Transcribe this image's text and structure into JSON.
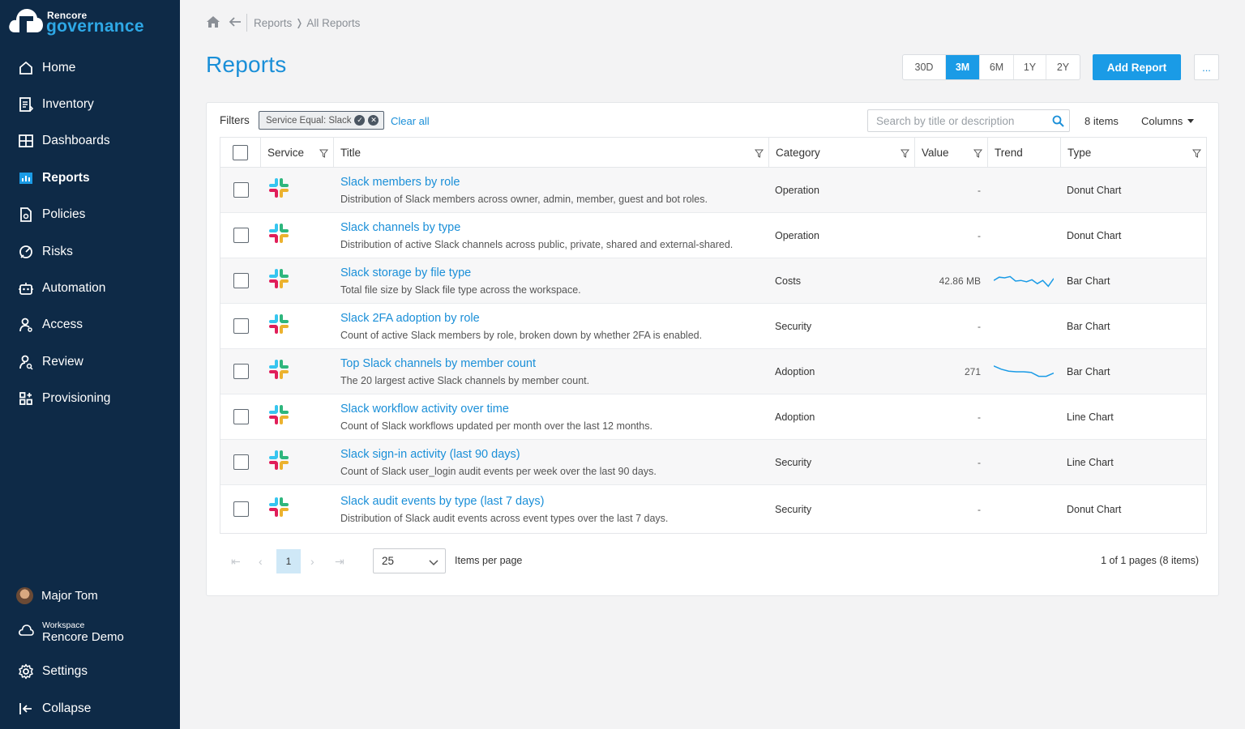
{
  "brand": {
    "top": "Rencore",
    "bottom": "governance"
  },
  "nav": [
    {
      "label": "Home",
      "icon": "home-icon"
    },
    {
      "label": "Inventory",
      "icon": "inventory-icon"
    },
    {
      "label": "Dashboards",
      "icon": "dashboards-icon"
    },
    {
      "label": "Reports",
      "icon": "reports-icon",
      "active": true
    },
    {
      "label": "Policies",
      "icon": "policies-icon"
    },
    {
      "label": "Risks",
      "icon": "risks-icon"
    },
    {
      "label": "Automation",
      "icon": "automation-icon"
    },
    {
      "label": "Access",
      "icon": "access-icon"
    },
    {
      "label": "Review",
      "icon": "review-icon"
    },
    {
      "label": "Provisioning",
      "icon": "provisioning-icon"
    }
  ],
  "user": {
    "name": "Major Tom"
  },
  "workspace": {
    "label": "Workspace",
    "name": "Rencore Demo"
  },
  "settings_label": "Settings",
  "collapse_label": "Collapse",
  "breadcrumb": {
    "parent": "Reports",
    "current": "All Reports"
  },
  "page_title": "Reports",
  "ranges": [
    "30D",
    "3M",
    "6M",
    "1Y",
    "2Y"
  ],
  "active_range": "3M",
  "add_report_label": "Add Report",
  "more_label": "...",
  "filters": {
    "label": "Filters",
    "chip": "Service Equal: Slack",
    "clear_all": "Clear all",
    "search_placeholder": "Search by title or description",
    "items_count": "8 items",
    "columns_label": "Columns"
  },
  "table": {
    "headers": {
      "service": "Service",
      "title": "Title",
      "category": "Category",
      "value": "Value",
      "trend": "Trend",
      "type": "Type"
    },
    "rows": [
      {
        "title": "Slack members by role",
        "desc": "Distribution of Slack members across owner, admin, member, guest and bot roles.",
        "category": "Operation",
        "value": "-",
        "trend": null,
        "type": "Donut Chart"
      },
      {
        "title": "Slack channels by type",
        "desc": "Distribution of active Slack channels across public, private, shared and external-shared.",
        "category": "Operation",
        "value": "-",
        "trend": null,
        "type": "Donut Chart"
      },
      {
        "title": "Slack storage by file type",
        "desc": "Total file size by Slack file type across the workspace.",
        "category": "Costs",
        "value": "42.86 MB",
        "trend": [
          0.45,
          0.2,
          0.25,
          0.15,
          0.5,
          0.45,
          0.55,
          0.4,
          0.7,
          0.45,
          0.9,
          0.3
        ],
        "type": "Bar Chart"
      },
      {
        "title": "Slack 2FA adoption by role",
        "desc": "Count of active Slack members by role, broken down by whether 2FA is enabled.",
        "category": "Security",
        "value": "-",
        "trend": null,
        "type": "Bar Chart"
      },
      {
        "title": "Top Slack channels by member count",
        "desc": "The 20 largest active Slack channels by member count.",
        "category": "Adoption",
        "value": "271",
        "trend": [
          0.05,
          0.3,
          0.45,
          0.5,
          0.5,
          0.55,
          0.85,
          0.85,
          0.6
        ],
        "type": "Bar Chart"
      },
      {
        "title": "Slack workflow activity over time",
        "desc": "Count of Slack workflows updated per month over the last 12 months.",
        "category": "Adoption",
        "value": "-",
        "trend": null,
        "type": "Line Chart"
      },
      {
        "title": "Slack sign-in activity (last 90 days)",
        "desc": "Count of Slack user_login audit events per week over the last 90 days.",
        "category": "Security",
        "value": "-",
        "trend": null,
        "type": "Line Chart"
      },
      {
        "title": "Slack audit events by type (last 7 days)",
        "desc": "Distribution of Slack audit events across event types over the last 7 days.",
        "category": "Security",
        "value": "-",
        "trend": null,
        "type": "Donut Chart"
      }
    ]
  },
  "pager": {
    "page": "1",
    "per_page": "25",
    "per_page_label": "Items per page",
    "info": "1 of 1 pages (8 items)"
  },
  "colors": {
    "sidebar": "#0e2a47",
    "accent": "#1a9be6",
    "link": "#1a8fd8"
  }
}
